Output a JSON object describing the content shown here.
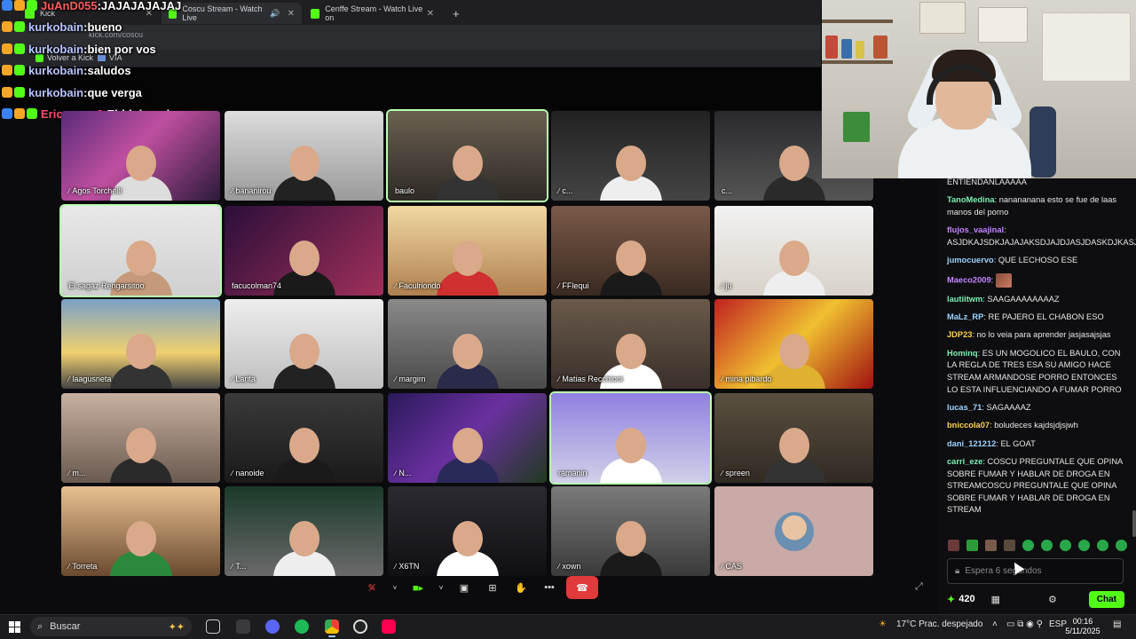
{
  "browser": {
    "tabs": [
      {
        "label": "Kick",
        "icon": "kick-icon",
        "color": "#53fc18"
      },
      {
        "label": "Coscu Stream - Watch Live",
        "icon": "kick-icon",
        "color": "#53fc18"
      },
      {
        "label": "Cenffe Stream - Watch Live on",
        "icon": "kick-icon",
        "color": "#53fc18"
      }
    ],
    "new_tab_label": "+",
    "url": "kick.com/coscu",
    "bookmarks": [
      {
        "label": "Volver a Kick"
      },
      {
        "label": "VIA"
      }
    ]
  },
  "overlay_chat": [
    {
      "user": "JuAnD055",
      "sep": ": ",
      "text": "JAJAJAJAJAJ",
      "color": "#ff5b5b"
    },
    {
      "user": "kurkobain",
      "sep": " : ",
      "text": "bueno",
      "color": "#b9c5ff"
    },
    {
      "user": "kurkobain",
      "sep": " : ",
      "text": "bien por vos",
      "color": "#b9c5ff"
    },
    {
      "user": "kurkobain",
      "sep": " : ",
      "text": "saludos",
      "color": "#b9c5ff"
    },
    {
      "user": "kurkobain",
      "sep": " : ",
      "text": "que verga",
      "color": "#b9c5ff"
    },
    {
      "user": "Ericvercm2",
      "sep": " : ",
      "text": "Ehhh juando",
      "color": "#ff4d6d"
    }
  ],
  "video_grid": [
    {
      "name": "Agos Torchelli",
      "muted": true
    },
    {
      "name": "bananirou",
      "muted": true
    },
    {
      "name": "baulo",
      "muted": false
    },
    {
      "name": "c...",
      "muted": true
    },
    {
      "name": "c...",
      "muted": false
    },
    {
      "name": "El sagaz Rengarsitoo",
      "muted": false
    },
    {
      "name": "facucolman74",
      "muted": false
    },
    {
      "name": "Faculriondo",
      "muted": true
    },
    {
      "name": "FFlequi",
      "muted": true
    },
    {
      "name": "ju",
      "muted": true
    },
    {
      "name": "laagusneta",
      "muted": true
    },
    {
      "name": "Larita",
      "muted": true
    },
    {
      "name": "margim",
      "muted": true
    },
    {
      "name": "Matias Recchioni",
      "muted": true
    },
    {
      "name": "mina pibardo",
      "muted": true
    },
    {
      "name": "m...",
      "muted": true
    },
    {
      "name": "nanoide",
      "muted": true
    },
    {
      "name": "N...",
      "muted": true
    },
    {
      "name": "ramanin",
      "muted": false
    },
    {
      "name": "spreen",
      "muted": true
    },
    {
      "name": "Torreta",
      "muted": true
    },
    {
      "name": "T...",
      "muted": true
    },
    {
      "name": "X6TN",
      "muted": true
    },
    {
      "name": "xown",
      "muted": true
    },
    {
      "name": "CAS",
      "muted": true
    }
  ],
  "call_controls": {
    "mic": "mic-off-icon",
    "camera": "camera-icon",
    "share": "share-screen-icon",
    "layout": "grid-layout-icon",
    "reactions": "hand-icon",
    "more": "•••",
    "hangup": "hangup-icon"
  },
  "chat_panel": {
    "messages": [
      {
        "user": "",
        "text": "ENTIENDANLAAAAA",
        "color": "#e6e6e6"
      },
      {
        "user": "TanoMedina",
        "text": "nanananana esto se fue de laas manos del porno",
        "color": "#7cf0b4"
      },
      {
        "user": "flujos_vaajinal",
        "text": "ASJDKAJSDKJAJAJAKSDJAJDJASJDASKDJKASJKJDKSJDA",
        "color": "#c584ff"
      },
      {
        "user": "jumocuervo",
        "text": "QUE LECHOSO ESE",
        "color": "#9bd3ff"
      },
      {
        "user": "Maeco2009",
        "text": "",
        "color": "#c584ff",
        "emote": true
      },
      {
        "user": "lautiitwm",
        "text": "SAAGAAAAAAAAZ",
        "color": "#7cf0b4"
      },
      {
        "user": "MaLz_RP",
        "text": "RE PAJERO EL CHABON ESO",
        "color": "#9bd3ff"
      },
      {
        "user": "JDP23",
        "text": "no lo veia para aprender jasjasajsjas",
        "color": "#ffd34d"
      },
      {
        "user": "Hominq",
        "text": "ES UN MOGOLICO EL BAULO, CON LA REGLA DE TRES ESA SU AMIGO HACE STREAM ARMANDOSE PORRO ENTONCES LO ESTA INFLUENCIANDO A FUMAR PORRO",
        "color": "#7cf0b4"
      },
      {
        "user": "lucas_71",
        "text": "SAGAAAAZ",
        "color": "#9bd3ff"
      },
      {
        "user": "bniccola07",
        "text": "boludeces kajdsjdjsjwh",
        "color": "#ffd34d"
      },
      {
        "user": "dani_121212",
        "text": "EL GOAT",
        "color": "#9bd3ff"
      },
      {
        "user": "carri_eze",
        "text": "COSCU PREGUNTALE QUE OPINA SOBRE FUMAR Y HABLAR DE DROGA EN STREAMCOSCU PREGUNTALE QUE OPINA SOBRE FUMAR Y HABLAR DE DROGA EN STREAM",
        "color": "#7cf0b4"
      }
    ],
    "input_placeholder": "Espera 6 segundos",
    "points": "420",
    "chat_button": "Chat"
  },
  "taskbar": {
    "search_label": "Buscar",
    "weather": "17°C  Prac. despejado",
    "lang": "ESP",
    "time": "00:16",
    "date": "5/11/2025"
  },
  "colors": {
    "kick_green": "#53fc18",
    "hangup_red": "#e03a3a"
  }
}
